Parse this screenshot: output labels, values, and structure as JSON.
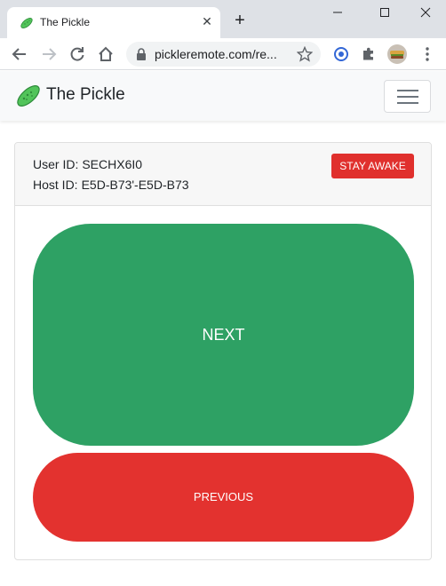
{
  "browser": {
    "tab_title": "The Pickle",
    "url": "pickleremote.com/re...",
    "new_tab_symbol": "+",
    "close_symbol": "✕"
  },
  "navbar": {
    "brand": "The Pickle"
  },
  "card": {
    "user_id_label": "User ID:",
    "user_id_value": "SECHX6I0",
    "host_id_label": "Host ID:",
    "host_id_value": "E5D-B73'-E5D-B73",
    "stay_awake_label": "STAY AWAKE"
  },
  "controls": {
    "next_label": "NEXT",
    "previous_label": "PREVIOUS"
  },
  "colors": {
    "next": "#2ea164",
    "previous": "#e3322f",
    "stay_awake": "#e0302d",
    "pickle": "#52c45a"
  }
}
